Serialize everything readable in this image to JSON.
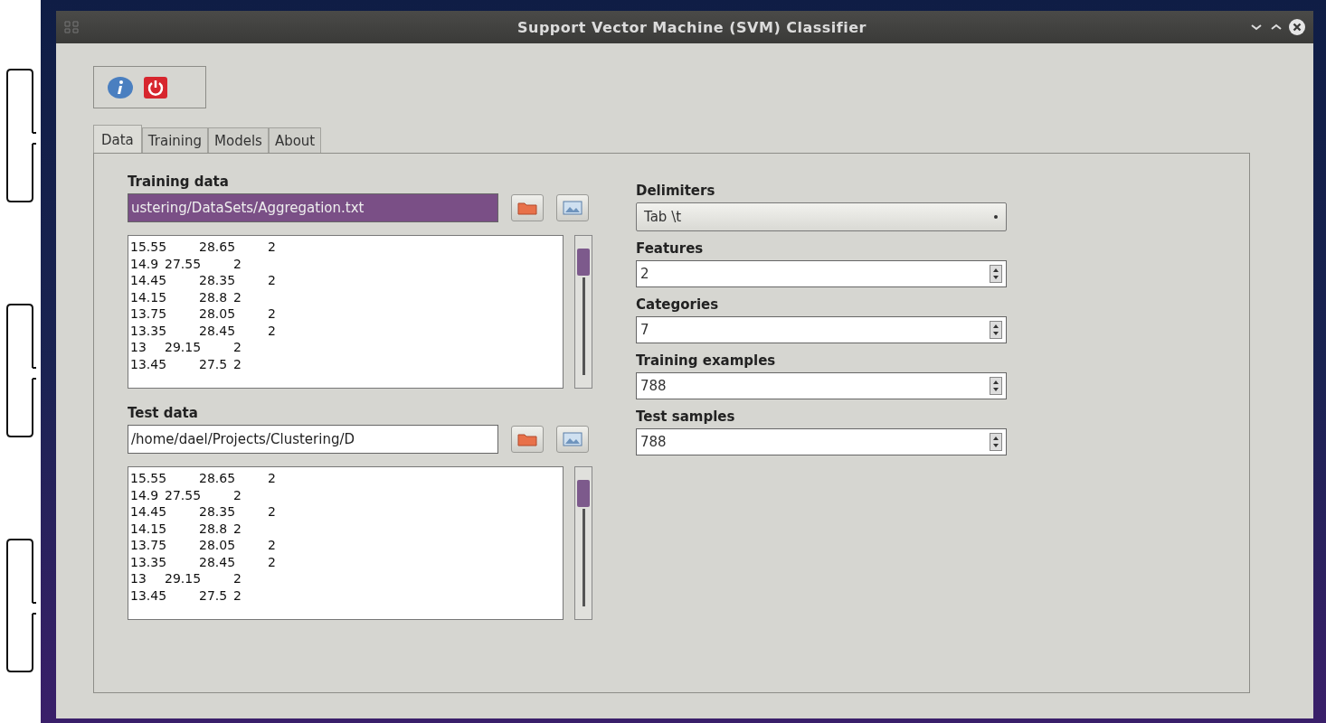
{
  "window": {
    "title": "Support Vector Machine (SVM) Classifier"
  },
  "tabs": [
    {
      "label": "Data",
      "selected": true
    },
    {
      "label": "Training",
      "selected": false
    },
    {
      "label": "Models",
      "selected": false
    },
    {
      "label": "About",
      "selected": false
    }
  ],
  "datasets": [
    {
      "label": "Training data",
      "path": "ustering/DataSets/Aggregation.txt",
      "text_selected": true,
      "rows": [
        "15.55\t28.65\t2",
        "14.9\t27.55\t2",
        "14.45\t28.35\t2",
        "14.15\t28.8\t2",
        "13.75\t28.05\t2",
        "13.35\t28.45\t2",
        "13\t29.15\t2",
        "13.45\t27.5\t2"
      ]
    },
    {
      "label": "Test data",
      "path": "/home/dael/Projects/Clustering/D",
      "text_selected": false,
      "rows": [
        "15.55\t28.65\t2",
        "14.9\t27.55\t2",
        "14.45\t28.35\t2",
        "14.15\t28.8\t2",
        "13.75\t28.05\t2",
        "13.35\t28.45\t2",
        "13\t29.15\t2",
        "13.45\t27.5\t2"
      ]
    }
  ],
  "settings": [
    {
      "kind": "dropdown",
      "label": "Delimiters",
      "value": "Tab \\t"
    },
    {
      "kind": "spinbox",
      "label": "Features",
      "value": "2"
    },
    {
      "kind": "spinbox",
      "label": "Categories",
      "value": "7"
    },
    {
      "kind": "spinbox",
      "label": "Training examples",
      "value": "788"
    },
    {
      "kind": "spinbox",
      "label": "Test samples",
      "value": "788"
    }
  ]
}
